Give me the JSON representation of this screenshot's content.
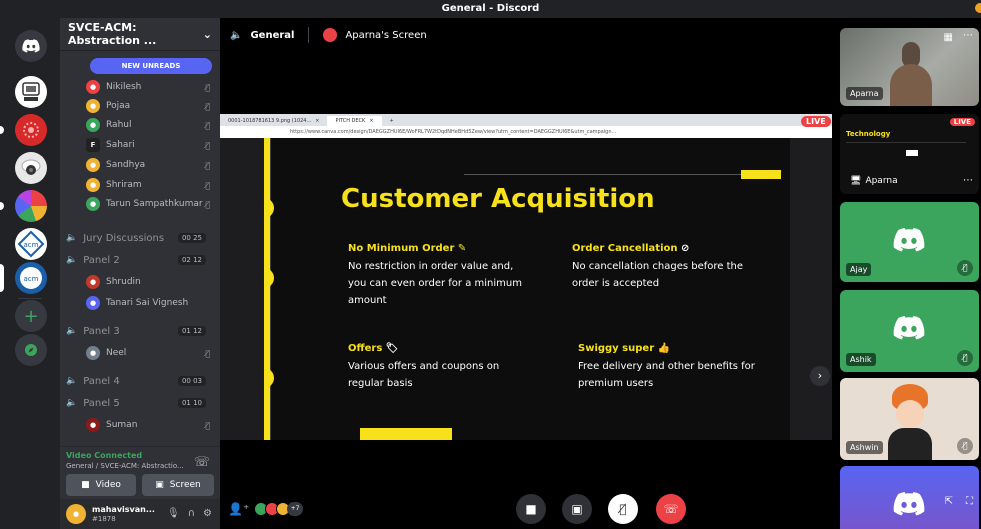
{
  "window": {
    "title": "General - Discord"
  },
  "server": {
    "name": "SVCE-ACM: Abstraction ..."
  },
  "new_unreads": "NEW UNREADS",
  "members_top": [
    {
      "name": "Nikilesh",
      "color": "#ed4245"
    },
    {
      "name": "Pojaa",
      "color": "#f0b232"
    },
    {
      "name": "Rahul",
      "color": "#3ba55d"
    },
    {
      "name": "Sahari",
      "color": "#222222"
    },
    {
      "name": "Sandhya",
      "color": "#f0b232"
    },
    {
      "name": "Shriram",
      "color": "#f0b232"
    },
    {
      "name": "Tarun Sampathkumar",
      "color": "#3ba55d"
    }
  ],
  "voice_channels": {
    "jury": {
      "name": "Jury Discussions",
      "count": "00 25"
    },
    "panel2": {
      "name": "Panel 2",
      "count": "02 12",
      "members": [
        "Shrudin",
        "Tanari Sai Vignesh"
      ]
    },
    "panel3": {
      "name": "Panel 3",
      "count": "01 12",
      "members": [
        "Neel"
      ]
    },
    "panel4": {
      "name": "Panel 4",
      "count": "00 03"
    },
    "panel5": {
      "name": "Panel 5",
      "count": "01 10",
      "members": [
        "Suman"
      ]
    }
  },
  "voice_status": {
    "title": "Video Connected",
    "subtitle": "General / SVCE-ACM: Abstractio..."
  },
  "buttons": {
    "video": "Video",
    "screen": "Screen"
  },
  "user": {
    "name": "mahavisvan...",
    "tag": "#1878"
  },
  "header": {
    "channel": "General",
    "screen": "Aparna's Screen"
  },
  "browser": {
    "tab1": "0001-1018781613 9.png (1024...",
    "tab2": "PITCH DECK",
    "url": "https://www.canva.com/design/DAEGGZHUI6E/WoFRL7W2tDqdNHeBHd5Zew/view?utm_content=DAEGGZHUI6E&utm_campaign..."
  },
  "live_label": "LIVE",
  "slide": {
    "title": "Customer Acquisition",
    "sections": [
      {
        "heading": "No Minimum Order",
        "body": [
          "No restriction in order value and,",
          "you can even order for a minimum",
          "amount"
        ]
      },
      {
        "heading": "Order Cancellation",
        "body": [
          "No cancellation chages before the",
          "order is accepted"
        ]
      },
      {
        "heading": "Offers",
        "body": [
          "Various offers and coupons on",
          "regular basis"
        ]
      },
      {
        "heading": "Swiggy super",
        "body": [
          "Free delivery and other benefits for",
          "premium users"
        ]
      }
    ]
  },
  "participants_extra": "+7",
  "tiles": [
    {
      "name": "Aparna",
      "type": "camera"
    },
    {
      "name": "Aparna",
      "type": "screen",
      "preview_title": "Technology",
      "preview_live": "LIVE"
    },
    {
      "name": "Ajay",
      "type": "avatar",
      "color": "#3ba55d"
    },
    {
      "name": "Ashik",
      "type": "avatar",
      "color": "#3ba55d"
    },
    {
      "name": "Ashwin",
      "type": "image"
    },
    {
      "name": "",
      "type": "avatar",
      "color": "#5865f2"
    }
  ]
}
